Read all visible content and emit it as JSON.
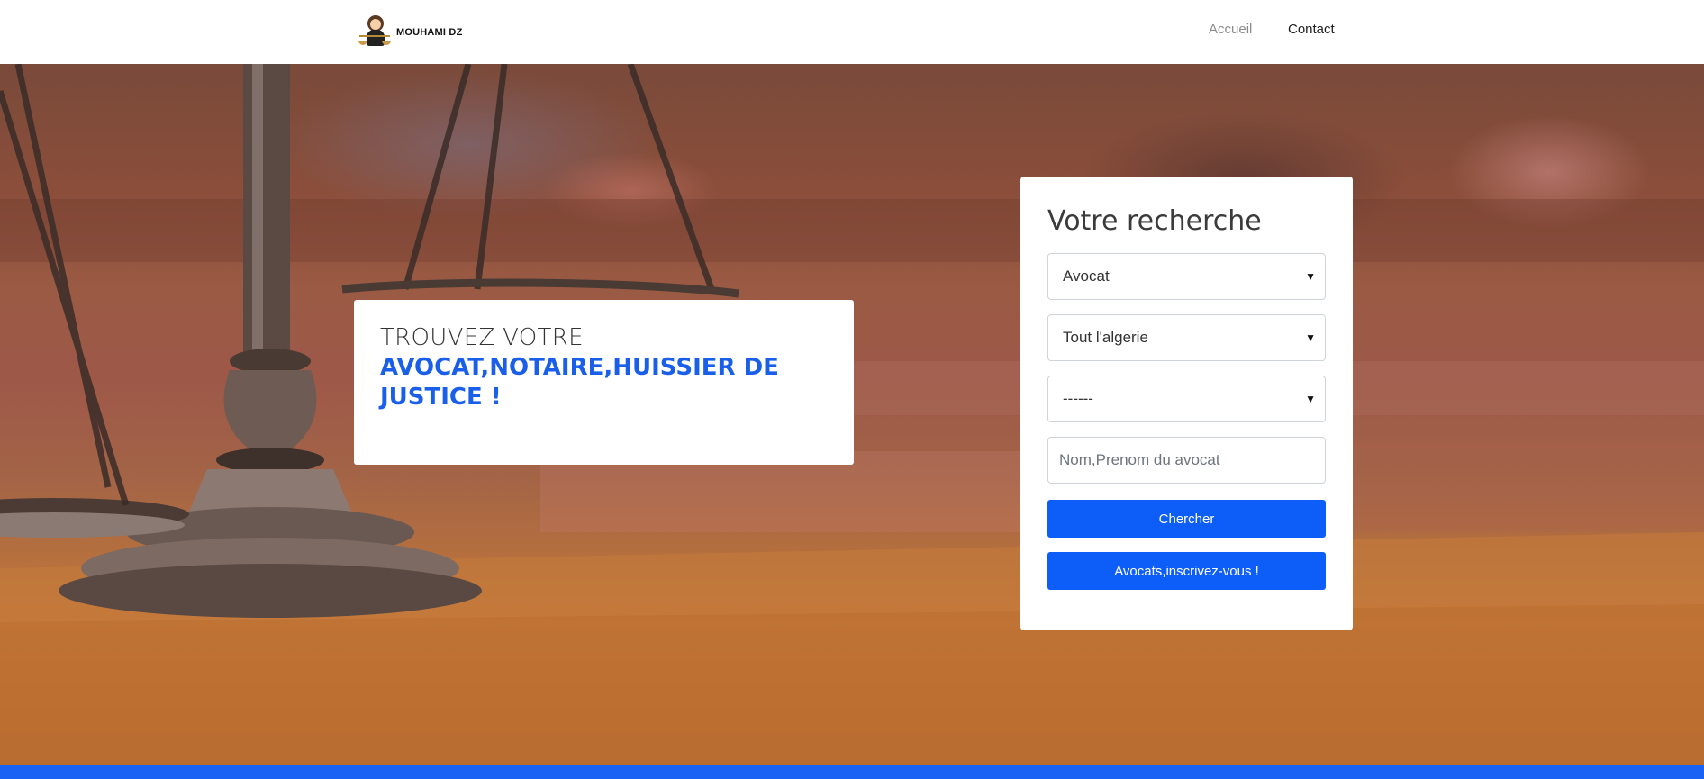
{
  "navbar": {
    "brand_name": "MOUHAMI DZ",
    "links": {
      "accueil": "Accueil",
      "contact": "Contact"
    }
  },
  "hero": {
    "line1": "TROUVEZ VOTRE",
    "line2": "AVOCAT,NOTAIRE,HUISSIER DE JUSTICE !"
  },
  "search": {
    "title": "Votre recherche",
    "profession_select": "Avocat",
    "region_select": "Tout l'algerie",
    "city_select": "------",
    "name_placeholder": "Nom,Prenom du avocat",
    "search_button": "Chercher",
    "register_button": "Avocats,inscrivez-vous !"
  },
  "colors": {
    "accent": "#0d5ef8",
    "hero_highlight": "#1a5fea",
    "bottom_bar": "#1a62f4"
  },
  "icons": [
    "logo-lawyer-icon",
    "chevron-down-icon"
  ]
}
